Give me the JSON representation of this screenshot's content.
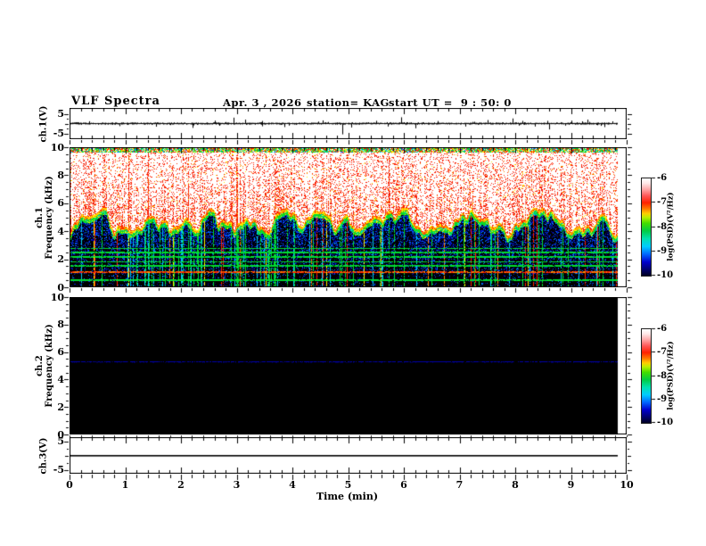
{
  "header": {
    "title": "VLF Spectra",
    "date": "Apr. 3 , 2026",
    "station": "station= KAG",
    "start_ut": "start UT =  9 : 50: 0"
  },
  "x_axis": {
    "label": "Time (min)",
    "tick_labels": [
      "0",
      "1",
      "2",
      "3",
      "4",
      "5",
      "6",
      "7",
      "8",
      "9",
      "10"
    ],
    "range": [
      0,
      10
    ]
  },
  "panels": {
    "ch1_wave": {
      "axis_label": "ch.1(V)",
      "tick_labels": [
        "5",
        "-5"
      ],
      "tick_values": [
        5,
        -5
      ]
    },
    "ch1_spec": {
      "axis_label": "ch.1\nFrequency (kHz)",
      "tick_labels": [
        "0",
        "2",
        "4",
        "6",
        "8",
        "10"
      ],
      "tick_values": [
        0,
        2,
        4,
        6,
        8,
        10
      ]
    },
    "ch2_spec": {
      "axis_label": "ch.2\nFrequency (kHz)",
      "tick_labels": [
        "0",
        "2",
        "4",
        "6",
        "8",
        "10"
      ],
      "tick_values": [
        0,
        2,
        4,
        6,
        8,
        10
      ]
    },
    "ch3_wave": {
      "axis_label": "ch.3(V)",
      "tick_labels": [
        "5",
        "-5"
      ],
      "tick_values": [
        5,
        -5
      ]
    }
  },
  "colorbar": {
    "label": "log(PSD)(V²/Hz)",
    "tick_labels": [
      "-6",
      "-7",
      "-8",
      "-9",
      "-10"
    ],
    "gradient_bottom_to_top": [
      "#000022 0%",
      "#000077 7%",
      "#0000cc 14%",
      "#0066ff 22%",
      "#00ccff 30%",
      "#00e0b0 38%",
      "#00cc44 46%",
      "#44dd00 54%",
      "#bbee00 60%",
      "#ffcc00 64%",
      "#ff7700 69%",
      "#ff2200 75%",
      "#ff5555 82%",
      "#ffaaaa 89%",
      "#ffe8e8 95%",
      "#ffffff 100%"
    ]
  },
  "chart_data": [
    {
      "panel": "ch.1 voltage waveform",
      "type": "line",
      "xlabel": "Time (min)",
      "xlim": [
        0,
        10
      ],
      "ylabel": "ch.1(V)",
      "ylim": [
        -5,
        5
      ],
      "data_end_min": 9.84,
      "signal": "broadband noise of ~±0.5 V around 0 V with impulsive spikes",
      "spikes": [
        {
          "t": 0.35,
          "v": 1.2
        },
        {
          "t": 0.9,
          "v": -1.3
        },
        {
          "t": 1.55,
          "v": -1.6
        },
        {
          "t": 2.2,
          "v": -2.2
        },
        {
          "t": 2.6,
          "v": 1.5
        },
        {
          "t": 2.95,
          "v": 3.0
        },
        {
          "t": 3.15,
          "v": 2.0
        },
        {
          "t": 3.45,
          "v": -1.4
        },
        {
          "t": 3.85,
          "v": -1.8
        },
        {
          "t": 4.55,
          "v": 1.6
        },
        {
          "t": 4.9,
          "v": -5.5
        },
        {
          "t": 5.05,
          "v": -2.0
        },
        {
          "t": 5.5,
          "v": 1.4
        },
        {
          "t": 5.95,
          "v": 3.2
        },
        {
          "t": 6.2,
          "v": -2.4
        },
        {
          "t": 6.6,
          "v": 1.3
        },
        {
          "t": 7.1,
          "v": -1.5
        },
        {
          "t": 7.5,
          "v": 1.8
        },
        {
          "t": 7.95,
          "v": 2.6
        },
        {
          "t": 8.35,
          "v": -1.5
        },
        {
          "t": 8.6,
          "v": -3.0
        },
        {
          "t": 9.0,
          "v": 1.5
        },
        {
          "t": 9.3,
          "v": 2.0
        },
        {
          "t": 9.6,
          "v": -1.8
        }
      ]
    },
    {
      "panel": "ch.1 spectrogram",
      "type": "heatmap",
      "xlim": [
        0,
        10
      ],
      "ylim": [
        0,
        10
      ],
      "ylabel": "ch.1 Frequency (kHz)",
      "colorbar_label": "log(PSD)(V²/Hz)",
      "colorbar_range": [
        -10,
        -6
      ],
      "data_end_min": 9.84,
      "structure": {
        "description": "saturated white/red region above ~4.5 kHz with dense red vertical streaks, jagged red-yellow-green boundary near 3.6-5.6 kHz, dark blue/black speckle below with green/cyan vertical streaks",
        "boundary_range_kHz": [
          3.6,
          5.6
        ],
        "top_mottled_band_kHz": [
          9.6,
          10
        ],
        "green_horizontal_lines_kHz": [
          2.8,
          2.5,
          2.2,
          1.85,
          1.55,
          0.55
        ],
        "orange_horizontal_line_kHz": 1.1
      }
    },
    {
      "panel": "ch.2 spectrogram",
      "type": "heatmap",
      "xlim": [
        0,
        10
      ],
      "ylim": [
        0,
        10
      ],
      "ylabel": "ch.2 Frequency (kHz)",
      "colorbar_range": [
        -10,
        -6
      ],
      "data_end_min": 9.84,
      "background": "uniform black (no signal)",
      "narrow_line_kHz": 5.3,
      "narrow_line_color": "#0000aa"
    },
    {
      "panel": "ch.3 voltage waveform",
      "type": "line",
      "xlim": [
        0,
        10
      ],
      "ylim": [
        -5,
        5
      ],
      "ylabel": "ch.3(V)",
      "data_end_min": 9.84,
      "signal": "flat line at 0 V"
    }
  ]
}
